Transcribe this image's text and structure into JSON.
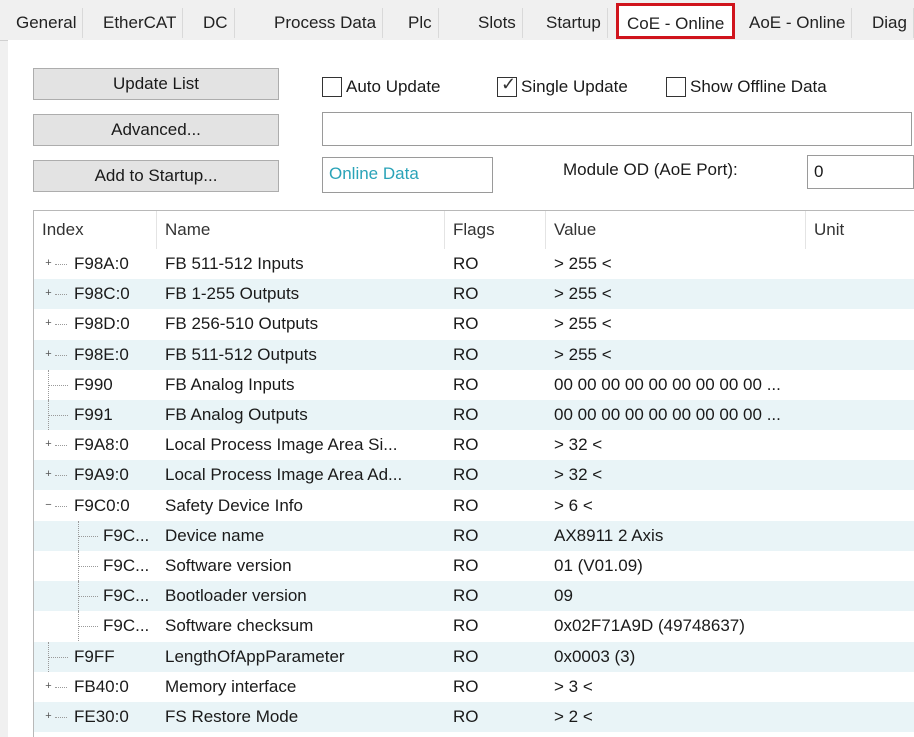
{
  "tabs": [
    "General",
    "EtherCAT",
    "DC",
    "Process Data",
    "Plc",
    "Slots",
    "Startup",
    "CoE - Online",
    "AoE - Online",
    "Diag"
  ],
  "active_tab": "CoE - Online",
  "highlight_color": "#d0141c",
  "buttons": {
    "update_list": "Update List",
    "advanced": "Advanced...",
    "add_to_startup": "Add to Startup..."
  },
  "checkboxes": {
    "auto_update": {
      "label": "Auto Update",
      "checked": false
    },
    "single_update": {
      "label": "Single Update",
      "checked": true
    },
    "show_offline": {
      "label": "Show Offline Data",
      "checked": false
    }
  },
  "filter_value": "",
  "online_data_label": "Online Data",
  "online_data_color": "#2aa3b8",
  "module_od_label": "Module OD (AoE Port):",
  "module_od_value": "0",
  "table": {
    "columns": [
      "Index",
      "Name",
      "Flags",
      "Value",
      "Unit"
    ],
    "rows": [
      {
        "index": "F98A:0",
        "name": "FB 511-512 Inputs",
        "flags": "RO",
        "value": "> 255 <",
        "unit": "",
        "expander": "+",
        "level": 0
      },
      {
        "index": "F98C:0",
        "name": "FB 1-255 Outputs",
        "flags": "RO",
        "value": "> 255 <",
        "unit": "",
        "expander": "+",
        "level": 0
      },
      {
        "index": "F98D:0",
        "name": "FB 256-510 Outputs",
        "flags": "RO",
        "value": "> 255 <",
        "unit": "",
        "expander": "+",
        "level": 0
      },
      {
        "index": "F98E:0",
        "name": "FB 511-512 Outputs",
        "flags": "RO",
        "value": "> 255 <",
        "unit": "",
        "expander": "+",
        "level": 0
      },
      {
        "index": "F990",
        "name": "FB Analog Inputs",
        "flags": "RO",
        "value": "00 00 00 00 00 00 00 00 00 ...",
        "unit": "",
        "expander": "",
        "level": 0
      },
      {
        "index": "F991",
        "name": "FB Analog Outputs",
        "flags": "RO",
        "value": "00 00 00 00 00 00 00 00 00 ...",
        "unit": "",
        "expander": "",
        "level": 0
      },
      {
        "index": "F9A8:0",
        "name": "Local Process Image Area Si...",
        "flags": "RO",
        "value": "> 32 <",
        "unit": "",
        "expander": "+",
        "level": 0
      },
      {
        "index": "F9A9:0",
        "name": "Local Process Image Area Ad...",
        "flags": "RO",
        "value": "> 32 <",
        "unit": "",
        "expander": "+",
        "level": 0
      },
      {
        "index": "F9C0:0",
        "name": "Safety Device Info",
        "flags": "RO",
        "value": "> 6 <",
        "unit": "",
        "expander": "−",
        "level": 0
      },
      {
        "index": "F9C...",
        "name": "Device name",
        "flags": "RO",
        "value": "AX8911 2 Axis",
        "unit": "",
        "expander": "",
        "level": 1
      },
      {
        "index": "F9C...",
        "name": "Software version",
        "flags": "RO",
        "value": "01 (V01.09)",
        "unit": "",
        "expander": "",
        "level": 1
      },
      {
        "index": "F9C...",
        "name": "Bootloader version",
        "flags": "RO",
        "value": "09",
        "unit": "",
        "expander": "",
        "level": 1
      },
      {
        "index": "F9C...",
        "name": "Software checksum",
        "flags": "RO",
        "value": "0x02F71A9D (49748637)",
        "unit": "",
        "expander": "",
        "level": 1
      },
      {
        "index": "F9FF",
        "name": "LengthOfAppParameter",
        "flags": "RO",
        "value": "0x0003 (3)",
        "unit": "",
        "expander": "",
        "level": 0
      },
      {
        "index": "FB40:0",
        "name": "Memory interface",
        "flags": "RO",
        "value": "> 3 <",
        "unit": "",
        "expander": "+",
        "level": 0
      },
      {
        "index": "FE30:0",
        "name": "FS Restore Mode",
        "flags": "RO",
        "value": "> 2 <",
        "unit": "",
        "expander": "+",
        "level": 0
      }
    ]
  }
}
